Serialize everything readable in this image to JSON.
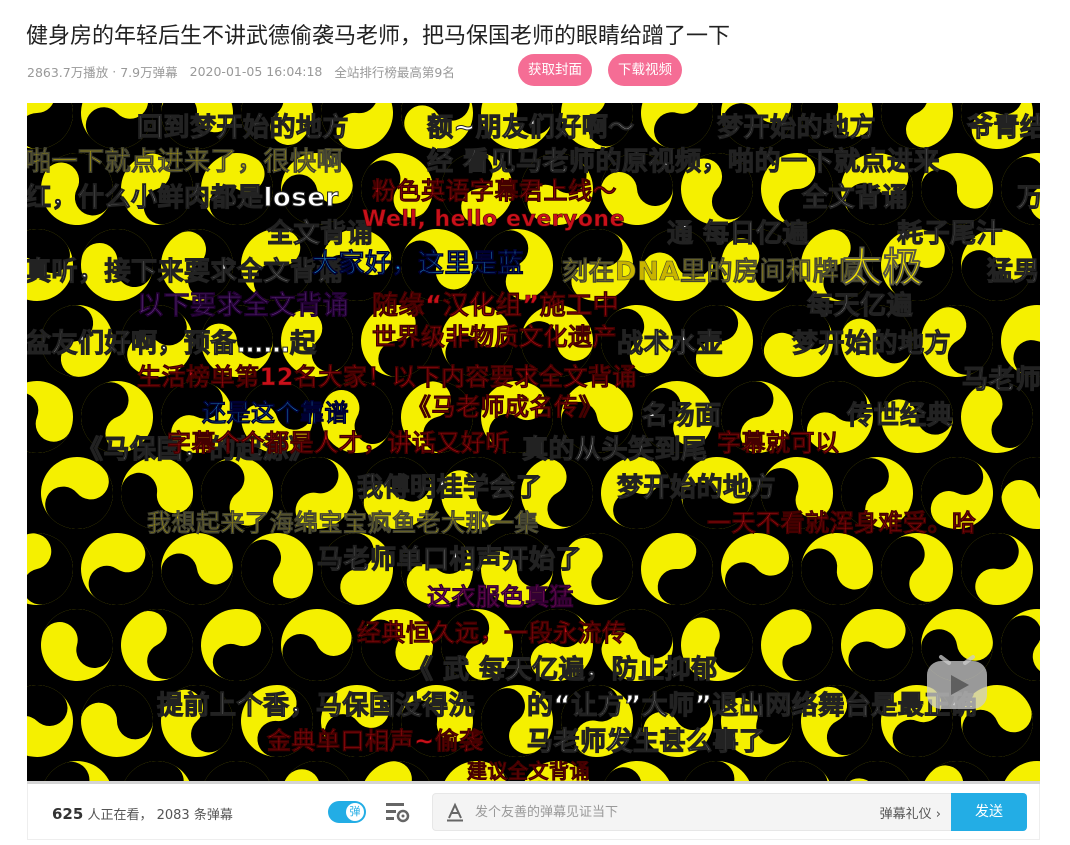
{
  "video": {
    "title": "健身房的年轻后生不讲武德偷袭马老师，把马保国老师的眼睛给蹭了一下",
    "plays": "2863.7万播放",
    "separator": "·",
    "danmaku_count": "7.9万弹幕",
    "datetime": "2020-01-05 16:04:18",
    "ranking": "全站排行榜最高第9名",
    "get_cover_label": "获取封面",
    "download_label": "下载视频"
  },
  "player": {
    "progress_fraction": 0.0,
    "danmaku": [
      {
        "text": "回到梦开始的地方",
        "color": "white"
      },
      {
        "text": "额~朋友们好啊～",
        "color": "white"
      },
      {
        "text": "梦开始的地方",
        "color": "white"
      },
      {
        "text": "爷青结",
        "color": "white"
      },
      {
        "text": "啪一下就点进来了，很快啊",
        "color": "yellow"
      },
      {
        "text": "经 看见马老师的原视频，啪的一下就点进来",
        "color": "white"
      },
      {
        "text": "红，什么小鲜肉都是loser",
        "color": "white"
      },
      {
        "text": "粉色英语字幕君上线～",
        "color": "red"
      },
      {
        "text": "全文背诵",
        "color": "white"
      },
      {
        "text": "万",
        "color": "white"
      },
      {
        "text": "全文背诵",
        "color": "white"
      },
      {
        "text": "Well, hello everyone",
        "color": "red"
      },
      {
        "text": "通 每日亿遍",
        "color": "white"
      },
      {
        "text": "耗子尾汁",
        "color": "white"
      },
      {
        "text": "真听，接下来要求全文背诵",
        "color": "white"
      },
      {
        "text": "大家好，这里是蓝",
        "color": "blue"
      },
      {
        "text": "刻在DNA里的房间和牌匾",
        "color": "yellow"
      },
      {
        "text": "猛男",
        "color": "white"
      },
      {
        "text": "太极",
        "color": "gold"
      },
      {
        "text": "以下要求全文背诵",
        "color": "purple"
      },
      {
        "text": "随缘“汉化组”施工中",
        "color": "red"
      },
      {
        "text": "每天亿遍",
        "color": "white"
      },
      {
        "text": "盆友们好啊，预备……起",
        "color": "white"
      },
      {
        "text": "世界级非物质文化遗产",
        "color": "red"
      },
      {
        "text": "战术水壶",
        "color": "white"
      },
      {
        "text": "梦开始的地方",
        "color": "white"
      },
      {
        "text": "生活榜单第12名大家！以下内容要求全文背诵",
        "color": "red"
      },
      {
        "text": "马老师",
        "color": "white"
      },
      {
        "text": "还是这个靠谱",
        "color": "blue"
      },
      {
        "text": "《马老师成名传》",
        "color": "red"
      },
      {
        "text": "名场面",
        "color": "white"
      },
      {
        "text": "传世经典",
        "color": "white"
      },
      {
        "text": "《马保国，的起源》",
        "color": "white"
      },
      {
        "text": "字幕个个都是人才，讲话又好听",
        "color": "red"
      },
      {
        "text": "真的从头笑到尾",
        "color": "white"
      },
      {
        "text": "字幕就可以",
        "color": "red"
      },
      {
        "text": "我傅明桂学会了",
        "color": "white"
      },
      {
        "text": "梦开始的地方",
        "color": "white"
      },
      {
        "text": "我想起来了海绵宝宝疯鱼老大那一集",
        "color": "yellow"
      },
      {
        "text": "一天不看就浑身难受。哈",
        "color": "red"
      },
      {
        "text": "马老师单口相声开始了",
        "color": "white"
      },
      {
        "text": "这衣服色真猛",
        "color": "magenta"
      },
      {
        "text": "经典恒久远，一段永流传",
        "color": "red"
      },
      {
        "text": "《 武 每天亿遍，防止抑郁",
        "color": "white"
      },
      {
        "text": "提前上个香，马保国没得洗",
        "color": "white"
      },
      {
        "text": "的“让方”大师”退出网络舞台是最正确",
        "color": "white"
      },
      {
        "text": "金典单口相声~偷袭",
        "color": "red"
      },
      {
        "text": "马老师发生甚么事了",
        "color": "white"
      },
      {
        "text": "建议全文背诵",
        "color": "red"
      }
    ]
  },
  "controls": {
    "viewers_count": "625",
    "viewers_label": "人正在看，",
    "danmaku_total": "2083 条弹幕",
    "toggle_label": "弹",
    "input_placeholder": "发个友善的弹幕见证当下",
    "gift_label": "弹幕礼仪 ›",
    "send_label": "发送"
  },
  "colors": {
    "accent": "#23ade5",
    "pink": "#f56d95",
    "yinyang_yellow": "#f5f000",
    "yinyang_black": "#000000"
  }
}
